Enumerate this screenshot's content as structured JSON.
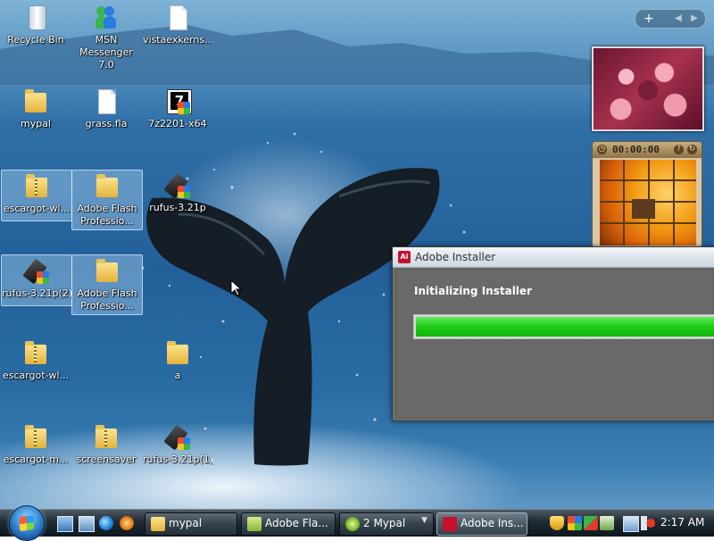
{
  "desktop": {
    "icons": [
      {
        "label": "Recycle Bin"
      },
      {
        "label": "MSN Messenger 7.0"
      },
      {
        "label": "vistaexkerns..."
      },
      {
        "label": "mypal"
      },
      {
        "label": "grass.fla"
      },
      {
        "label": "7z2201-x64"
      },
      {
        "label": "escargot-wl..."
      },
      {
        "label": "Adobe Flash Professio..."
      },
      {
        "label": "rufus-3.21p"
      },
      {
        "label": "rufus-3.21p(2)"
      },
      {
        "label": "Adobe Flash Professio..."
      },
      {
        "label": "escargot-wl..."
      },
      {
        "label": "a"
      },
      {
        "label": "escargot-m..."
      },
      {
        "label": "screensaver"
      },
      {
        "label": "rufus-3.21p(1)"
      }
    ]
  },
  "gadgets": {
    "sidebar_add": "+",
    "puzzle_timer": "00:00:00",
    "puzzle_help": "?"
  },
  "installer": {
    "title": "Adobe Installer",
    "heading": "Initializing Installer",
    "progress_fraction": 1.0,
    "progress_color": "#21cf1a"
  },
  "taskbar": {
    "tasks": [
      {
        "label": "mypal"
      },
      {
        "label": "Adobe Fla..."
      },
      {
        "label": "2 Mypal",
        "count": "2"
      },
      {
        "label": "Adobe Ins..."
      }
    ],
    "clock": "2:17 AM"
  },
  "colors": {
    "accent": "#21cf1a",
    "taskbar": "#1f2932",
    "window_body": "#6e6e6e"
  }
}
